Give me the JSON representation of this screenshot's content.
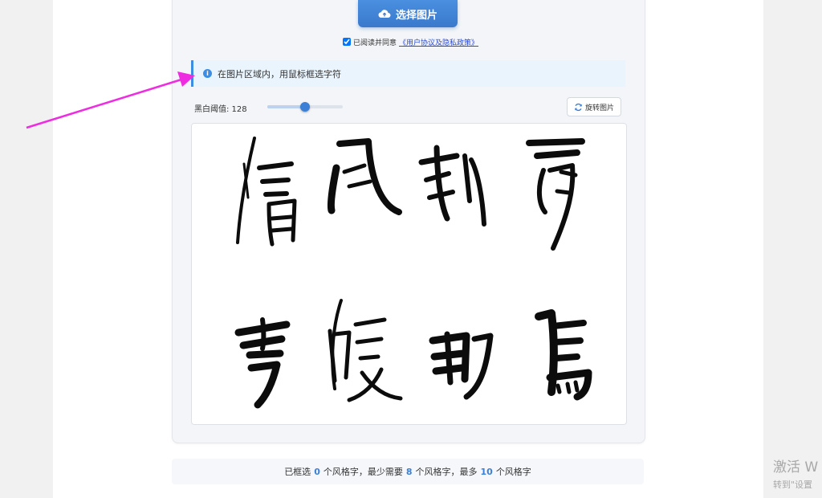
{
  "upload": {
    "label": "选择图片",
    "icon": "cloud-upload-icon"
  },
  "agreement": {
    "checked": true,
    "text": "已阅读并同意",
    "link": "《用户协议及隐私政策》"
  },
  "info": {
    "message": "在图片区域内，用鼠标框选字符",
    "icon": "info-icon"
  },
  "threshold": {
    "label": "黑白阈值: 128",
    "value": 128,
    "min": 0,
    "max": 255
  },
  "rotate": {
    "label": "旋转图片",
    "icon": "refresh-icon"
  },
  "image": {
    "row1": [
      "清",
      "風",
      "和",
      "暖"
    ],
    "row2": [
      "雪",
      "暖",
      "野",
      "馬"
    ]
  },
  "stats": {
    "prefix": "已框选",
    "selected": "0",
    "seg1": "个风格字，最少需要",
    "min": "8",
    "seg2": "个风格字，最多",
    "max": "10",
    "seg3": "个风格字"
  },
  "watermark": {
    "line1": "激活 W",
    "line2": "转到\"设置"
  },
  "colors": {
    "accent": "#3b80d6",
    "arrow": "#ee2de0",
    "info_bg": "#e9f4fd"
  }
}
